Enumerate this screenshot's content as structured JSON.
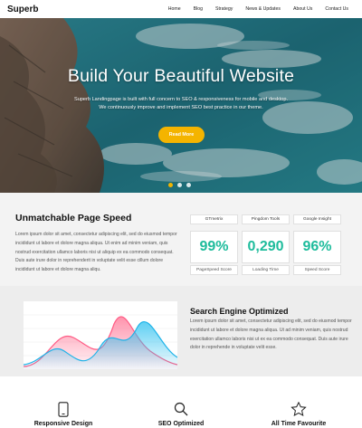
{
  "nav": {
    "brand": "Superb",
    "items": [
      "Home",
      "Blog",
      "Strategy",
      "News & Updates",
      "About Us",
      "Contact Us"
    ]
  },
  "hero": {
    "title": "Build Your Beautiful Website",
    "line1": "Superb Landingpage is built with full concern to SEO & responsiveness for mobile and desktop.",
    "line2": "We continuously improve and implement SEO best practice in our theme.",
    "button": "Read More",
    "slide_count": 3,
    "active_slide": 1
  },
  "speed": {
    "title": "Unmatchable Page Speed",
    "body": "Lorem ipsum dolor sit amet, consectetur adipiscing elit, sed do eiusmod tempor incididunt ut labore et dolore magna aliqua. Ut enim ad minim veniam, quis nostrud exercitation ullamco laboris nisi ut aliquip ex ea commodo consequat. Duis aute irure dolor in reprehenderit in voluptate velit esse cillum dolore incididunt ut labore et dolore magna aliqu.",
    "cards": [
      {
        "tool": "GTmetrix",
        "value": "99%",
        "metric": "PageSpeed Score"
      },
      {
        "tool": "Pingdom Tools",
        "value": "0,290",
        "metric": "Loading Time"
      },
      {
        "tool": "Google Insight",
        "value": "96%",
        "metric": "Speed Score"
      }
    ]
  },
  "seo": {
    "title": "Search Engine Optimized",
    "body": "Lorem ipsum dolor sit amet, consectetur adipiscing elit, sed do eiusmod tempor incididunt ut labore et dolore magna aliqua. Ut ad minim veniam, quis nostrud exercitation ullamco laboris nisi ut ex ea commodo consequat. Duis aute irure dolor in reprehende in voluptate velit esse."
  },
  "features": [
    {
      "icon": "phone-icon",
      "label": "Responsive Design"
    },
    {
      "icon": "search-icon",
      "label": "SEO Optimized"
    },
    {
      "icon": "star-icon",
      "label": "All Time Favourite"
    }
  ],
  "colors": {
    "accent": "#f4b400",
    "metric": "#1ebc9c"
  }
}
